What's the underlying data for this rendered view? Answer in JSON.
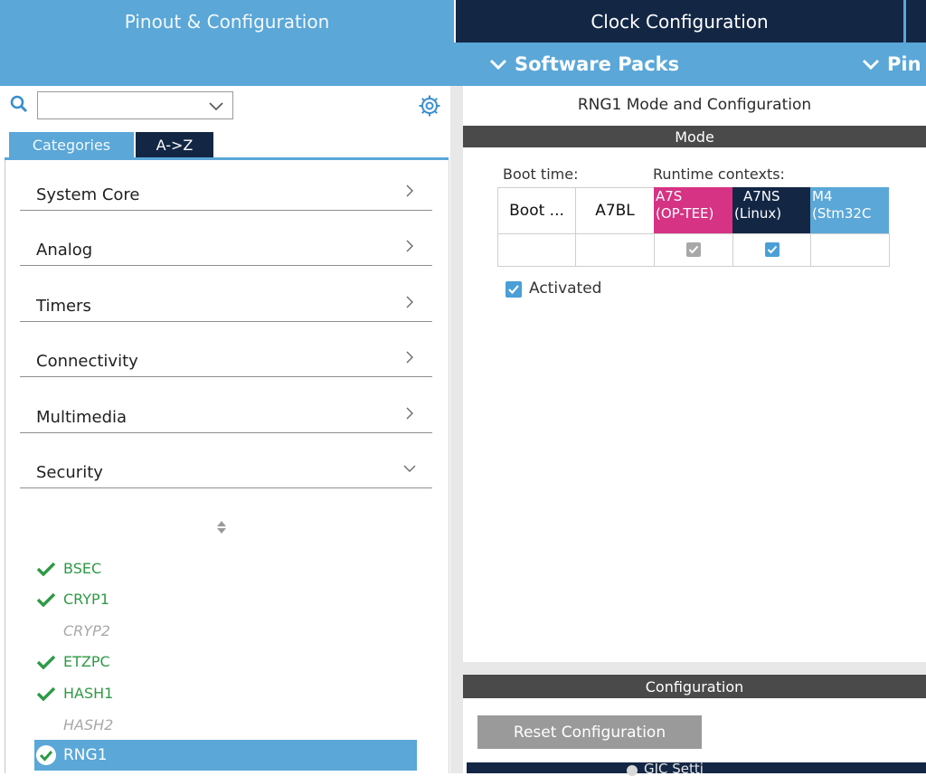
{
  "top_tabs": {
    "pinout": "Pinout & Configuration",
    "clock": "Clock Configuration"
  },
  "subbar": {
    "software_packs": "Software Packs",
    "pinout_partial": "Pin"
  },
  "left": {
    "tabs": {
      "categories": "Categories",
      "az": "A->Z"
    },
    "categories": [
      {
        "label": "System Core",
        "state": "collapsed"
      },
      {
        "label": "Analog",
        "state": "collapsed"
      },
      {
        "label": "Timers",
        "state": "collapsed"
      },
      {
        "label": "Connectivity",
        "state": "collapsed"
      },
      {
        "label": "Multimedia",
        "state": "collapsed"
      },
      {
        "label": "Security",
        "state": "expanded"
      }
    ],
    "security_items": [
      {
        "label": "BSEC",
        "status": "configured"
      },
      {
        "label": "CRYP1",
        "status": "configured"
      },
      {
        "label": "CRYP2",
        "status": "disabled"
      },
      {
        "label": "ETZPC",
        "status": "configured"
      },
      {
        "label": "HASH1",
        "status": "configured"
      },
      {
        "label": "HASH2",
        "status": "disabled"
      },
      {
        "label": "RNG1",
        "status": "selected"
      }
    ]
  },
  "right": {
    "title": "RNG1 Mode and Configuration",
    "mode_header": "Mode",
    "boot_time_label": "Boot time:",
    "runtime_label": "Runtime contexts:",
    "boot_cols": [
      "Boot ...",
      "A7BL"
    ],
    "contexts": [
      {
        "line1": "A7S",
        "line2": "(OP-TEE)",
        "color": "#d63384",
        "checked": true,
        "enabled": false
      },
      {
        "line1": "A7NS",
        "line2": "(Linux)",
        "color": "#132745",
        "checked": true,
        "enabled": true
      },
      {
        "line1": "M4",
        "line2": "(Stm32C",
        "color": "#5aa7d8",
        "checked": false,
        "enabled": true
      }
    ],
    "activated_label": "Activated",
    "activated": true,
    "config_header": "Configuration",
    "reset_button": "Reset Configuration",
    "params_label": "GIC Setti"
  },
  "colors": {
    "accent": "#5aa7d8",
    "navy": "#132745",
    "ok_green": "#2e9a45",
    "optee_pink": "#d63384"
  }
}
